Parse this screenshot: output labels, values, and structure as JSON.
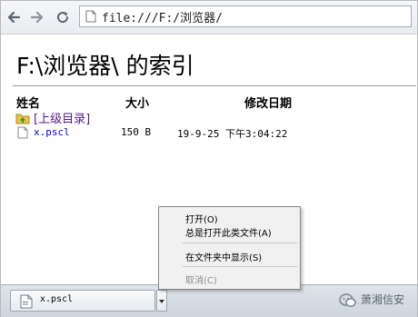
{
  "toolbar": {
    "back_icon": "back-arrow-icon",
    "forward_icon": "forward-arrow-icon",
    "reload_icon": "reload-icon",
    "address": "file:///F:/浏览器/"
  },
  "page": {
    "heading": "F:\\浏览器\\ 的索引",
    "columns": {
      "name": "姓名",
      "size": "大小",
      "modified": "修改日期"
    },
    "parent_link": "[上级目录]",
    "files": [
      {
        "name": "x.pscl",
        "size": "150 B",
        "modified": "19-9-25 下午3:04:22"
      }
    ]
  },
  "context_menu": {
    "items": [
      {
        "label": "打开(O)",
        "enabled": true
      },
      {
        "label": "总是打开此类文件(A)",
        "enabled": true
      },
      {
        "label": "在文件夹中显示(S)",
        "enabled": true
      },
      {
        "label": "取消(C)",
        "enabled": false
      }
    ]
  },
  "download_shelf": {
    "file_name": "x.pscl"
  },
  "watermark": {
    "text": "萧湘信安"
  },
  "colors": {
    "visited_link": "#551a8b",
    "link": "#0000ee",
    "menu_bg": "#f1f1f1",
    "disabled_text": "#8d8d8d"
  }
}
